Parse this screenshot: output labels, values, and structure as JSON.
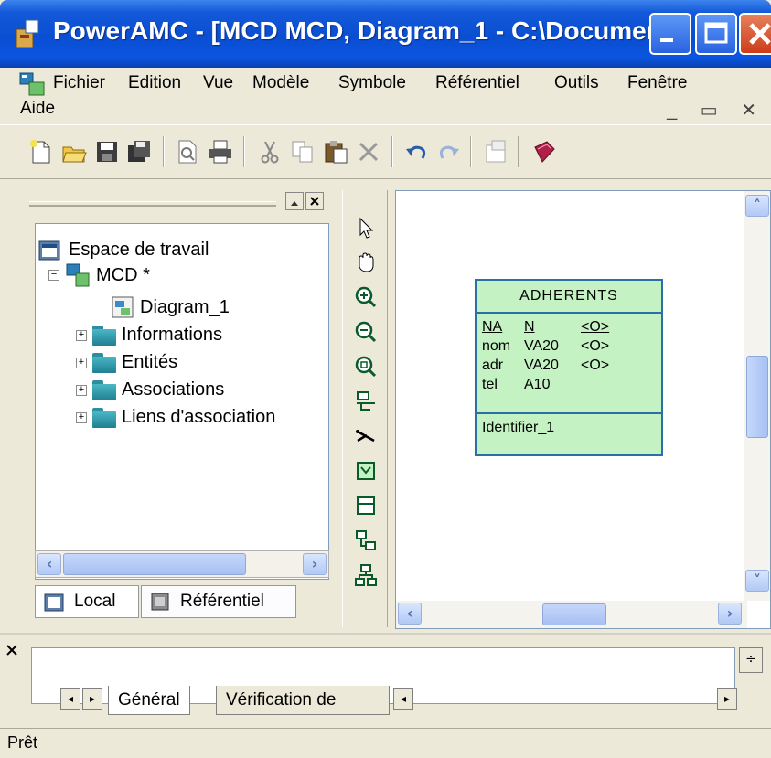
{
  "window": {
    "title": "PowerAMC - [MCD MCD, Diagram_1 - C:\\Document..."
  },
  "menu": {
    "items": [
      "Fichier",
      "Edition",
      "Vue",
      "Modèle",
      "Symbole",
      "Référentiel",
      "Outils",
      "Fenêtre"
    ],
    "row2": "Aide"
  },
  "toolbar": {
    "icons": [
      "new-icon",
      "open-icon",
      "save-icon",
      "save-all-icon",
      "print-preview-icon",
      "print-icon",
      "cut-icon",
      "copy-icon",
      "paste-icon",
      "delete-icon",
      "undo-icon",
      "redo-icon",
      "properties-icon",
      "help-icon"
    ]
  },
  "browser": {
    "tree": {
      "root": "Espace de travail",
      "model": "MCD *",
      "diagram": "Diagram_1",
      "folders": [
        "Informations",
        "Entités",
        "Associations",
        "Liens d'association"
      ]
    },
    "tabs": [
      "Local",
      "Référentiel"
    ],
    "active_tab": "Local"
  },
  "palette": {
    "tools": [
      "pointer-icon",
      "grabber-icon",
      "zoom-in-icon",
      "zoom-out-icon",
      "zoom-fit-icon",
      "text-icon",
      "link-icon",
      "entity-icon",
      "table-icon",
      "inheritance-icon",
      "relationship-icon"
    ]
  },
  "entity": {
    "name": "ADHERENTS",
    "attributes": [
      {
        "name": "NA",
        "type": "N",
        "flag": "<O>"
      },
      {
        "name": "nom",
        "type": "VA20",
        "flag": "<O>"
      },
      {
        "name": "adr",
        "type": "VA20",
        "flag": "<O>"
      },
      {
        "name": "tel",
        "type": "A10",
        "flag": ""
      }
    ],
    "identifier": "Identifier_1"
  },
  "output": {
    "tabs": [
      "Général",
      "Vérification de"
    ]
  },
  "status": {
    "text": "Prêt"
  }
}
